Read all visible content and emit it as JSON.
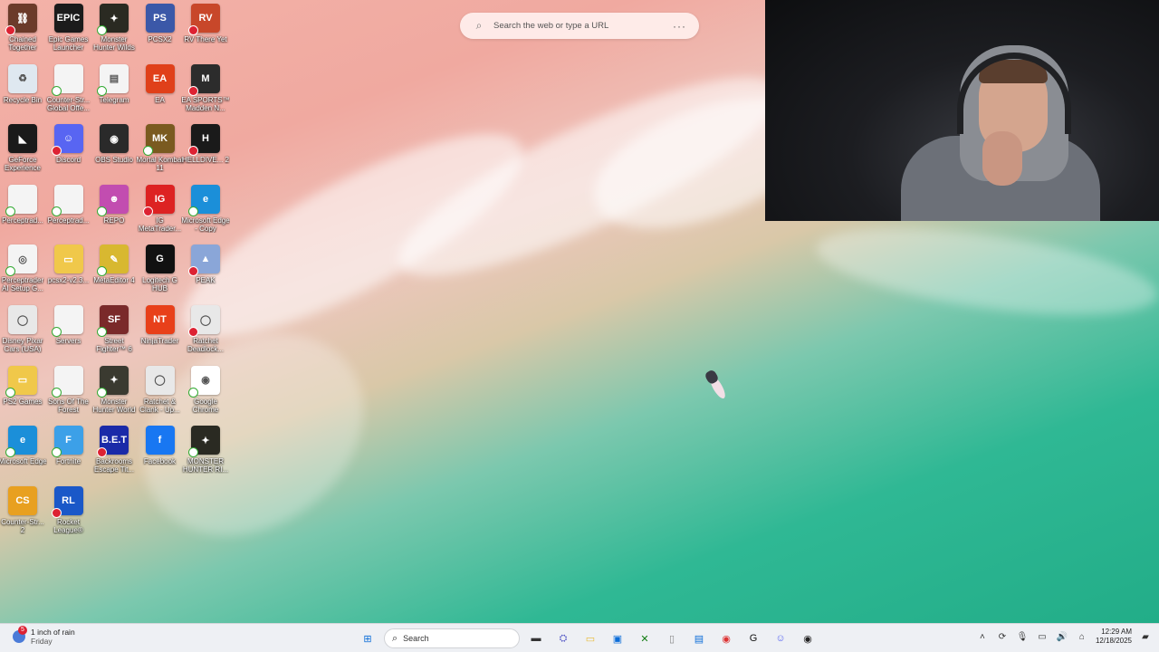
{
  "desktop": {
    "icons": [
      {
        "label": "Chained Together",
        "color": "#6b3b2a",
        "glyph": "⛓",
        "badge": "x"
      },
      {
        "label": "Epic Games Launcher",
        "color": "#1b1b1b",
        "glyph": "EPIC",
        "badge": ""
      },
      {
        "label": "Monster Hunter Wilds",
        "color": "#2a2a22",
        "glyph": "✦",
        "badge": "ok"
      },
      {
        "label": "PCSX2",
        "color": "#3b58a8",
        "glyph": "PS",
        "badge": ""
      },
      {
        "label": "RV There Yet",
        "color": "#c8472a",
        "glyph": "RV",
        "badge": "x"
      },
      {
        "label": "Recycle Bin",
        "color": "#dfe8f0",
        "glyph": "♻",
        "badge": ""
      },
      {
        "label": "Counter-Str... Global Offe...",
        "color": "#f4f4f4",
        "glyph": "",
        "badge": "ok"
      },
      {
        "label": "Telegram",
        "color": "#f4f4f4",
        "glyph": "▤",
        "badge": "ok"
      },
      {
        "label": "EA",
        "color": "#e0401a",
        "glyph": "EA",
        "badge": ""
      },
      {
        "label": "EA SPORTS™ Madden N...",
        "color": "#2c2c2c",
        "glyph": "M",
        "badge": "x"
      },
      {
        "label": "GeForce Experience",
        "color": "#1a1a1a",
        "glyph": "◣",
        "badge": ""
      },
      {
        "label": "Discord",
        "color": "#5865f2",
        "glyph": "☺",
        "badge": "x"
      },
      {
        "label": "OBS Studio",
        "color": "#2a2a2a",
        "glyph": "◉",
        "badge": ""
      },
      {
        "label": "Mortal Kombat 11",
        "color": "#7a5a20",
        "glyph": "MK",
        "badge": "ok"
      },
      {
        "label": "HELLDIVE... 2",
        "color": "#1a1a1a",
        "glyph": "H",
        "badge": "x"
      },
      {
        "label": "Perceptrad...",
        "color": "#f4f4f4",
        "glyph": "",
        "badge": "ok"
      },
      {
        "label": "Perceptrad...",
        "color": "#f4f4f4",
        "glyph": "",
        "badge": "ok"
      },
      {
        "label": "REPO",
        "color": "#c24db0",
        "glyph": "☻",
        "badge": "ok"
      },
      {
        "label": "IG MetaTrader...",
        "color": "#d22",
        "glyph": "IG",
        "badge": "x"
      },
      {
        "label": "Microsoft Edge - Copy",
        "color": "#1b8fd9",
        "glyph": "e",
        "badge": "ok"
      },
      {
        "label": "Perceptrader AI Setup G...",
        "color": "#f4f4f4",
        "glyph": "◎",
        "badge": "ok"
      },
      {
        "label": "pcsx2-v2.3...",
        "color": "#f0c84a",
        "glyph": "▭",
        "badge": ""
      },
      {
        "label": "MetaEditor 4",
        "color": "#d8b830",
        "glyph": "✎",
        "badge": "ok"
      },
      {
        "label": "Logitech G HUB",
        "color": "#111",
        "glyph": "G",
        "badge": ""
      },
      {
        "label": "PEAK",
        "color": "#8aa6d8",
        "glyph": "▲",
        "badge": "x"
      },
      {
        "label": "Disney Pixar Cars (USA)",
        "color": "#e8e8e8",
        "glyph": "◯",
        "badge": ""
      },
      {
        "label": "Servers",
        "color": "#f4f4f4",
        "glyph": "",
        "badge": "ok"
      },
      {
        "label": "Street Fighter™ 6",
        "color": "#7a2a2a",
        "glyph": "SF",
        "badge": "ok"
      },
      {
        "label": "NinjaTrader",
        "color": "#e8401a",
        "glyph": "NT",
        "badge": ""
      },
      {
        "label": "Ratchet Deadlock...",
        "color": "#e8e8e8",
        "glyph": "◯",
        "badge": "x"
      },
      {
        "label": "PS2 Games",
        "color": "#f0c84a",
        "glyph": "▭",
        "badge": "ok"
      },
      {
        "label": "Sons Of The Forest",
        "color": "#f4f4f4",
        "glyph": "",
        "badge": "ok"
      },
      {
        "label": "Monster Hunter World",
        "color": "#3a3a30",
        "glyph": "✦",
        "badge": "ok"
      },
      {
        "label": "Ratchet & Clank - Up...",
        "color": "#e8e8e8",
        "glyph": "◯",
        "badge": ""
      },
      {
        "label": "Google Chrome",
        "color": "#fff",
        "glyph": "◉",
        "badge": "ok"
      },
      {
        "label": "Microsoft Edge",
        "color": "#1b8fd9",
        "glyph": "e",
        "badge": "ok"
      },
      {
        "label": "Fortnite",
        "color": "#3ca0e8",
        "glyph": "F",
        "badge": "ok"
      },
      {
        "label": "Backrooms Escape Tit...",
        "color": "#1a2aa8",
        "glyph": "B.E.T",
        "badge": "x"
      },
      {
        "label": "Facebook",
        "color": "#1877f2",
        "glyph": "f",
        "badge": ""
      },
      {
        "label": "MONSTER HUNTER RI...",
        "color": "#2a2a22",
        "glyph": "✦",
        "badge": "ok"
      },
      {
        "label": "Counter-Str... 2",
        "color": "#e8a020",
        "glyph": "CS",
        "badge": ""
      },
      {
        "label": "Rocket League®",
        "color": "#1a58c8",
        "glyph": "RL",
        "badge": "x"
      }
    ]
  },
  "browser_search": {
    "placeholder": "Search the web or type a URL",
    "search_icon": "search-icon",
    "more_icon": "more-icon"
  },
  "taskbar": {
    "weather_text": "1 inch of rain",
    "weather_day": "Friday",
    "weather_badge": "5",
    "search_label": "Search",
    "pinned": [
      {
        "name": "start-button",
        "glyph": "⊞",
        "color": "#0a6cd8"
      },
      {
        "name": "task-view-button",
        "glyph": "▬",
        "color": "#333"
      },
      {
        "name": "teams-icon",
        "glyph": "⛭",
        "color": "#5b5fc7"
      },
      {
        "name": "file-explorer-icon",
        "glyph": "▭",
        "color": "#e8b830"
      },
      {
        "name": "store-icon",
        "glyph": "▣",
        "color": "#0a6cd8"
      },
      {
        "name": "xbox-icon",
        "glyph": "✕",
        "color": "#107c10"
      },
      {
        "name": "notepad-icon",
        "glyph": "▯",
        "color": "#888"
      },
      {
        "name": "telegram-icon",
        "glyph": "▤",
        "color": "#0a6cd8"
      },
      {
        "name": "chrome-icon",
        "glyph": "◉",
        "color": "#d33"
      },
      {
        "name": "logitech-icon",
        "glyph": "G",
        "color": "#111"
      },
      {
        "name": "discord-icon",
        "glyph": "☺",
        "color": "#5865f2"
      },
      {
        "name": "obs-icon",
        "glyph": "◉",
        "color": "#222"
      }
    ],
    "time": "12:29 AM",
    "date": "12/18/2025"
  }
}
